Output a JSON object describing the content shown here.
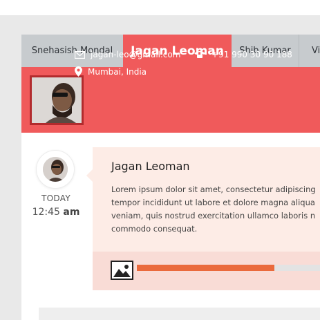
{
  "tabs": [
    {
      "label": "Snehasish Mondal",
      "active": false
    },
    {
      "label": "Jagan Leoman",
      "active": true
    },
    {
      "label": "Shib Kumar",
      "active": false
    },
    {
      "label": "Vi",
      "active": false
    }
  ],
  "profile": {
    "email": "jagan-leo@gmail.com",
    "phone": "+91 990 30 90 188",
    "location": "Mumbai, India",
    "email_icon": "envelope-icon",
    "phone_icon": "telephone-icon",
    "location_icon": "map-pin-icon"
  },
  "timeline": {
    "day": "TODAY",
    "time": "12:45",
    "ampm": "am"
  },
  "post": {
    "title": "Jagan Leoman",
    "body_lines": [
      "Lorem ipsum dolor sit amet, consectetur adipiscing",
      "tempor incididunt ut labore et dolore magna aliqua",
      "veniam, quis nostrud exercitation ullamco laboris n",
      "commodo consequat."
    ],
    "media_icon": "image-icon",
    "progress": 0.71
  },
  "colors": {
    "accent": "#f05a5b",
    "tab_bar": "#c7cbce",
    "avatar_border": "#b22b2d",
    "bubble": "#fdece6",
    "bubble_footer": "#f9dcd6",
    "progress": "#ea6a3c"
  }
}
